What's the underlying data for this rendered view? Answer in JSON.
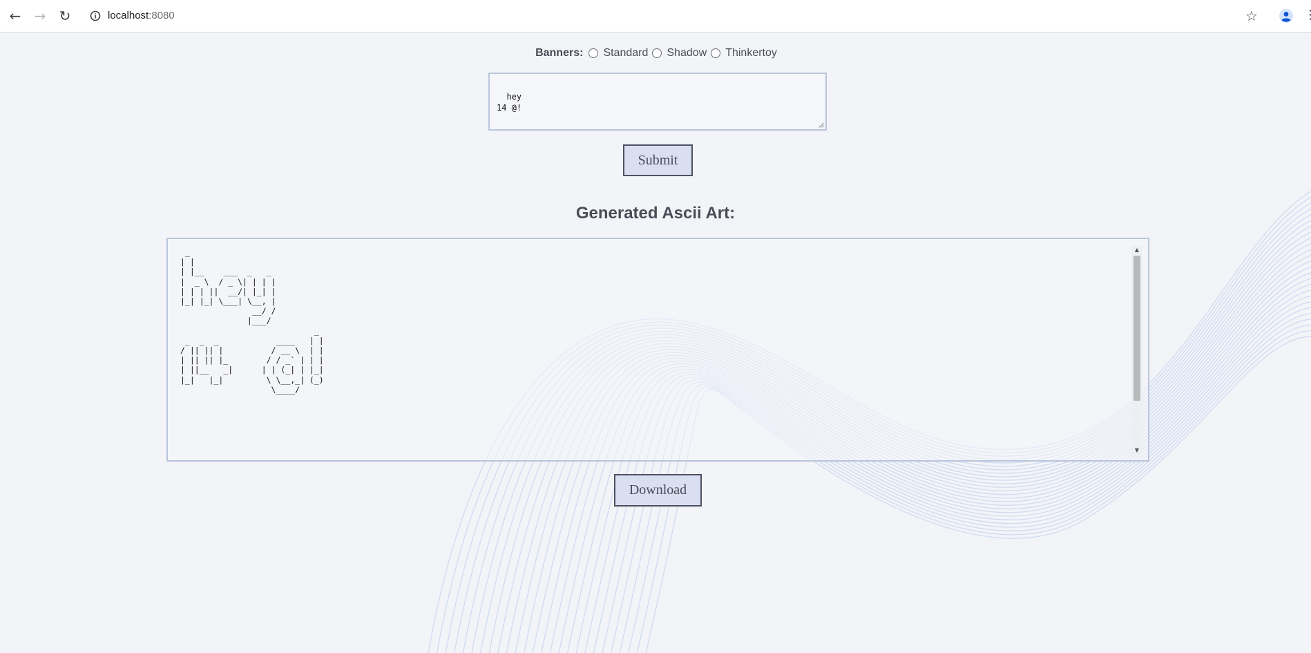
{
  "browser": {
    "back_icon": "←",
    "forward_icon": "→",
    "reload_icon": "↻",
    "url_host": "localhost",
    "url_port": ":8080",
    "star_icon": "☆",
    "menu_icon": "⋮"
  },
  "form": {
    "banners_label": "Banners:",
    "banner_options": [
      "Standard",
      "Shadow",
      "Thinkertoy"
    ],
    "input_value": "hey\n14 @!",
    "submit_label": "Submit"
  },
  "output": {
    "title": "Generated Ascii Art:",
    "ascii_art": " _                    \n| |                   \n| |__    ___  _   _   \n|  _ \\  / _ \\| | | |  \n| | | ||  __/| |_| |  \n|_| |_| \\___| \\__, |  \n               __/ /  \n              |___/   \n                            _  \n _  _  _            ____   | | \n/ || || |          / __ \\  | | \n| || || |_        / / _` | | | \n| ||__   _|      | | (_| | |_| \n|_|   |_|         \\ \\__,_| (_) \n                   \\____/      ",
    "download_label": "Download"
  },
  "colors": {
    "page_bg": "#f3f4f8",
    "button_bg": "#d9def1",
    "border_accent": "#b9c5dc",
    "text": "#4a4d57"
  }
}
